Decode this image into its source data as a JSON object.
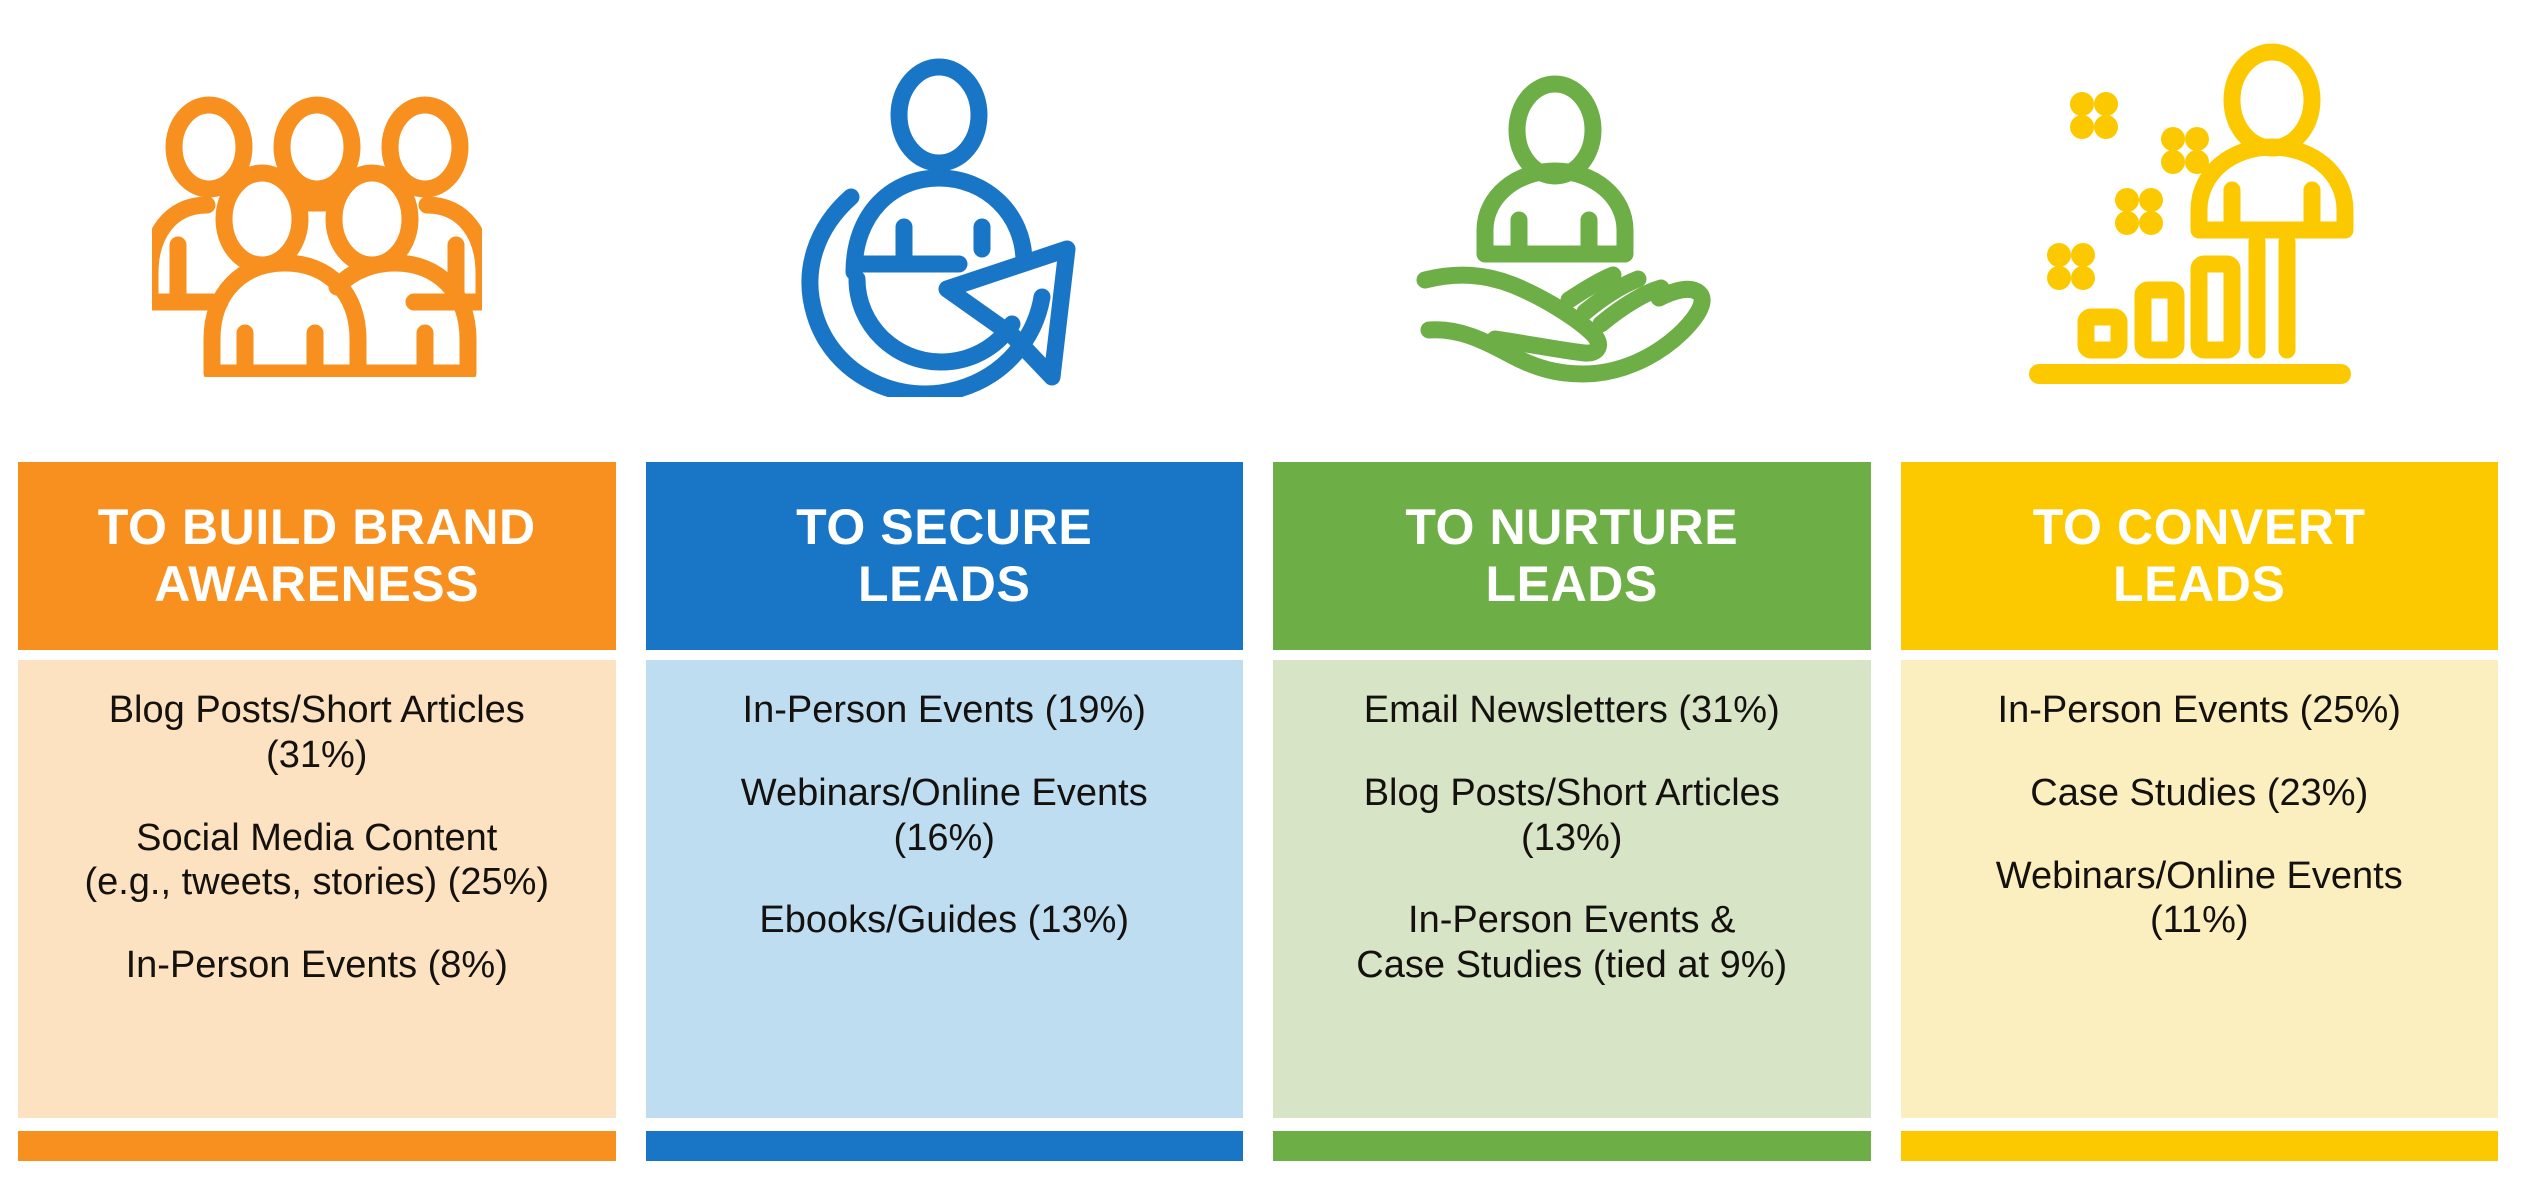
{
  "columns": [
    {
      "id": "build-brand-awareness",
      "icon": "people-group-icon",
      "title": "TO BUILD BRAND\nAWARENESS",
      "accent": "#F7901E",
      "tint": "#FCE2C0",
      "items": [
        "Blog Posts/Short Articles\n(31%)",
        "Social Media Content\n(e.g., tweets, stories) (25%)",
        "In-Person Events (8%)"
      ]
    },
    {
      "id": "secure-leads",
      "icon": "person-refresh-arrow-icon",
      "title": "TO SECURE\nLEADS",
      "accent": "#1976C6",
      "tint": "#BEDDF1",
      "items": [
        "In-Person Events (19%)",
        "Webinars/Online Events\n(16%)",
        "Ebooks/Guides (13%)"
      ]
    },
    {
      "id": "nurture-leads",
      "icon": "person-on-hand-icon",
      "title": "TO NURTURE\nLEADS",
      "accent": "#6DAE47",
      "tint": "#D7E4C6",
      "items": [
        "Email Newsletters (31%)",
        "Blog Posts/Short Articles\n(13%)",
        "In-Person Events &\nCase Studies (tied at 9%)"
      ]
    },
    {
      "id": "convert-leads",
      "icon": "person-growth-chart-icon",
      "title": "TO CONVERT\nLEADS",
      "accent": "#FCC900",
      "tint": "#FBEFC0",
      "items": [
        "In-Person Events (25%)",
        "Case Studies (23%)",
        "Webinars/Online Events\n(11%)"
      ]
    }
  ]
}
